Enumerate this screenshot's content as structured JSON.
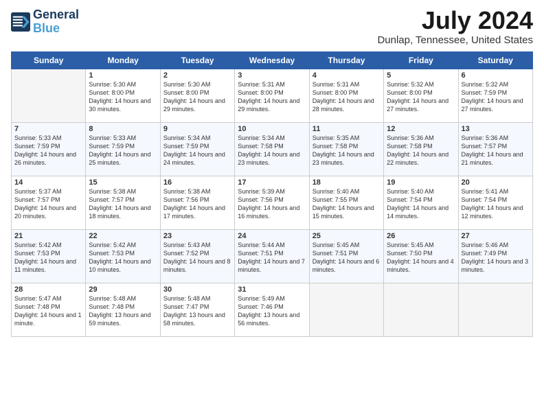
{
  "header": {
    "logo_line1": "General",
    "logo_line2": "Blue",
    "month_year": "July 2024",
    "location": "Dunlap, Tennessee, United States"
  },
  "weekdays": [
    "Sunday",
    "Monday",
    "Tuesday",
    "Wednesday",
    "Thursday",
    "Friday",
    "Saturday"
  ],
  "weeks": [
    [
      {
        "day": "",
        "sunrise": "",
        "sunset": "",
        "daylight": "",
        "empty": true
      },
      {
        "day": "1",
        "sunrise": "Sunrise: 5:30 AM",
        "sunset": "Sunset: 8:00 PM",
        "daylight": "Daylight: 14 hours and 30 minutes."
      },
      {
        "day": "2",
        "sunrise": "Sunrise: 5:30 AM",
        "sunset": "Sunset: 8:00 PM",
        "daylight": "Daylight: 14 hours and 29 minutes."
      },
      {
        "day": "3",
        "sunrise": "Sunrise: 5:31 AM",
        "sunset": "Sunset: 8:00 PM",
        "daylight": "Daylight: 14 hours and 29 minutes."
      },
      {
        "day": "4",
        "sunrise": "Sunrise: 5:31 AM",
        "sunset": "Sunset: 8:00 PM",
        "daylight": "Daylight: 14 hours and 28 minutes."
      },
      {
        "day": "5",
        "sunrise": "Sunrise: 5:32 AM",
        "sunset": "Sunset: 8:00 PM",
        "daylight": "Daylight: 14 hours and 27 minutes."
      },
      {
        "day": "6",
        "sunrise": "Sunrise: 5:32 AM",
        "sunset": "Sunset: 7:59 PM",
        "daylight": "Daylight: 14 hours and 27 minutes."
      }
    ],
    [
      {
        "day": "7",
        "sunrise": "Sunrise: 5:33 AM",
        "sunset": "Sunset: 7:59 PM",
        "daylight": "Daylight: 14 hours and 26 minutes."
      },
      {
        "day": "8",
        "sunrise": "Sunrise: 5:33 AM",
        "sunset": "Sunset: 7:59 PM",
        "daylight": "Daylight: 14 hours and 25 minutes."
      },
      {
        "day": "9",
        "sunrise": "Sunrise: 5:34 AM",
        "sunset": "Sunset: 7:59 PM",
        "daylight": "Daylight: 14 hours and 24 minutes."
      },
      {
        "day": "10",
        "sunrise": "Sunrise: 5:34 AM",
        "sunset": "Sunset: 7:58 PM",
        "daylight": "Daylight: 14 hours and 23 minutes."
      },
      {
        "day": "11",
        "sunrise": "Sunrise: 5:35 AM",
        "sunset": "Sunset: 7:58 PM",
        "daylight": "Daylight: 14 hours and 23 minutes."
      },
      {
        "day": "12",
        "sunrise": "Sunrise: 5:36 AM",
        "sunset": "Sunset: 7:58 PM",
        "daylight": "Daylight: 14 hours and 22 minutes."
      },
      {
        "day": "13",
        "sunrise": "Sunrise: 5:36 AM",
        "sunset": "Sunset: 7:57 PM",
        "daylight": "Daylight: 14 hours and 21 minutes."
      }
    ],
    [
      {
        "day": "14",
        "sunrise": "Sunrise: 5:37 AM",
        "sunset": "Sunset: 7:57 PM",
        "daylight": "Daylight: 14 hours and 20 minutes."
      },
      {
        "day": "15",
        "sunrise": "Sunrise: 5:38 AM",
        "sunset": "Sunset: 7:57 PM",
        "daylight": "Daylight: 14 hours and 18 minutes."
      },
      {
        "day": "16",
        "sunrise": "Sunrise: 5:38 AM",
        "sunset": "Sunset: 7:56 PM",
        "daylight": "Daylight: 14 hours and 17 minutes."
      },
      {
        "day": "17",
        "sunrise": "Sunrise: 5:39 AM",
        "sunset": "Sunset: 7:56 PM",
        "daylight": "Daylight: 14 hours and 16 minutes."
      },
      {
        "day": "18",
        "sunrise": "Sunrise: 5:40 AM",
        "sunset": "Sunset: 7:55 PM",
        "daylight": "Daylight: 14 hours and 15 minutes."
      },
      {
        "day": "19",
        "sunrise": "Sunrise: 5:40 AM",
        "sunset": "Sunset: 7:54 PM",
        "daylight": "Daylight: 14 hours and 14 minutes."
      },
      {
        "day": "20",
        "sunrise": "Sunrise: 5:41 AM",
        "sunset": "Sunset: 7:54 PM",
        "daylight": "Daylight: 14 hours and 12 minutes."
      }
    ],
    [
      {
        "day": "21",
        "sunrise": "Sunrise: 5:42 AM",
        "sunset": "Sunset: 7:53 PM",
        "daylight": "Daylight: 14 hours and 11 minutes."
      },
      {
        "day": "22",
        "sunrise": "Sunrise: 5:42 AM",
        "sunset": "Sunset: 7:53 PM",
        "daylight": "Daylight: 14 hours and 10 minutes."
      },
      {
        "day": "23",
        "sunrise": "Sunrise: 5:43 AM",
        "sunset": "Sunset: 7:52 PM",
        "daylight": "Daylight: 14 hours and 8 minutes."
      },
      {
        "day": "24",
        "sunrise": "Sunrise: 5:44 AM",
        "sunset": "Sunset: 7:51 PM",
        "daylight": "Daylight: 14 hours and 7 minutes."
      },
      {
        "day": "25",
        "sunrise": "Sunrise: 5:45 AM",
        "sunset": "Sunset: 7:51 PM",
        "daylight": "Daylight: 14 hours and 6 minutes."
      },
      {
        "day": "26",
        "sunrise": "Sunrise: 5:45 AM",
        "sunset": "Sunset: 7:50 PM",
        "daylight": "Daylight: 14 hours and 4 minutes."
      },
      {
        "day": "27",
        "sunrise": "Sunrise: 5:46 AM",
        "sunset": "Sunset: 7:49 PM",
        "daylight": "Daylight: 14 hours and 3 minutes."
      }
    ],
    [
      {
        "day": "28",
        "sunrise": "Sunrise: 5:47 AM",
        "sunset": "Sunset: 7:48 PM",
        "daylight": "Daylight: 14 hours and 1 minute."
      },
      {
        "day": "29",
        "sunrise": "Sunrise: 5:48 AM",
        "sunset": "Sunset: 7:48 PM",
        "daylight": "Daylight: 13 hours and 59 minutes."
      },
      {
        "day": "30",
        "sunrise": "Sunrise: 5:48 AM",
        "sunset": "Sunset: 7:47 PM",
        "daylight": "Daylight: 13 hours and 58 minutes."
      },
      {
        "day": "31",
        "sunrise": "Sunrise: 5:49 AM",
        "sunset": "Sunset: 7:46 PM",
        "daylight": "Daylight: 13 hours and 56 minutes."
      },
      {
        "day": "",
        "sunrise": "",
        "sunset": "",
        "daylight": "",
        "empty": true
      },
      {
        "day": "",
        "sunrise": "",
        "sunset": "",
        "daylight": "",
        "empty": true
      },
      {
        "day": "",
        "sunrise": "",
        "sunset": "",
        "daylight": "",
        "empty": true
      }
    ]
  ]
}
